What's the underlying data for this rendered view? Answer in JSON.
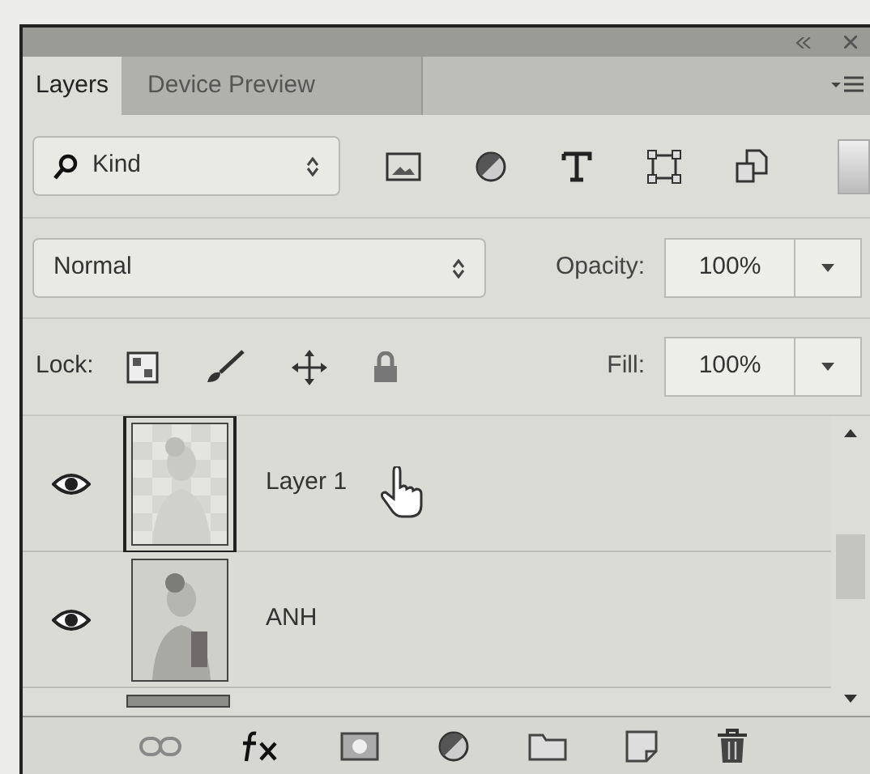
{
  "tabs": [
    {
      "label": "Layers",
      "selected": true
    },
    {
      "label": "Device Preview",
      "selected": false
    }
  ],
  "filter": {
    "value": "Kind"
  },
  "blend_mode": {
    "value": "Normal"
  },
  "opacity": {
    "label": "Opacity:",
    "value": "100%"
  },
  "lock": {
    "label": "Lock:"
  },
  "fill": {
    "label": "Fill:",
    "value": "100%"
  },
  "layers": [
    {
      "name": "Layer 1",
      "visible": true,
      "selected": true
    },
    {
      "name": "ANH",
      "visible": true,
      "selected": false
    }
  ]
}
